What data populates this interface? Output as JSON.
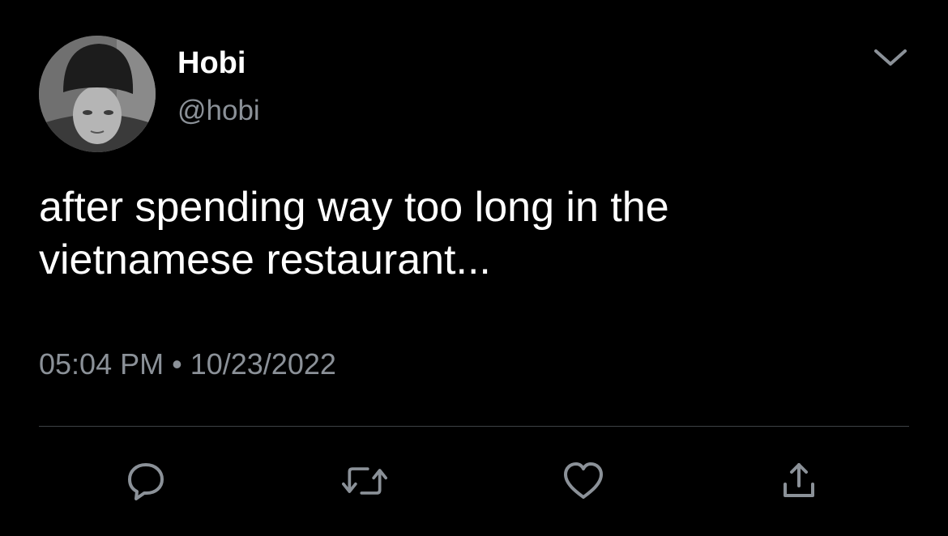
{
  "user": {
    "display_name": "Hobi",
    "handle": "@hobi",
    "avatar_icon": "profile-photo"
  },
  "tweet": {
    "text": "after spending way too long in the\nvietnamese restaurant...",
    "time": "05:04 PM",
    "separator": "•",
    "date": "10/23/2022"
  },
  "actions": {
    "reply_icon": "reply-icon",
    "retweet_icon": "retweet-icon",
    "like_icon": "heart-icon",
    "share_icon": "share-icon",
    "more_icon": "chevron-down-icon"
  },
  "colors": {
    "background": "#000000",
    "text_primary": "#ffffff",
    "text_secondary": "#8b9198",
    "divider": "#3d4146",
    "icon": "#8b9198"
  }
}
